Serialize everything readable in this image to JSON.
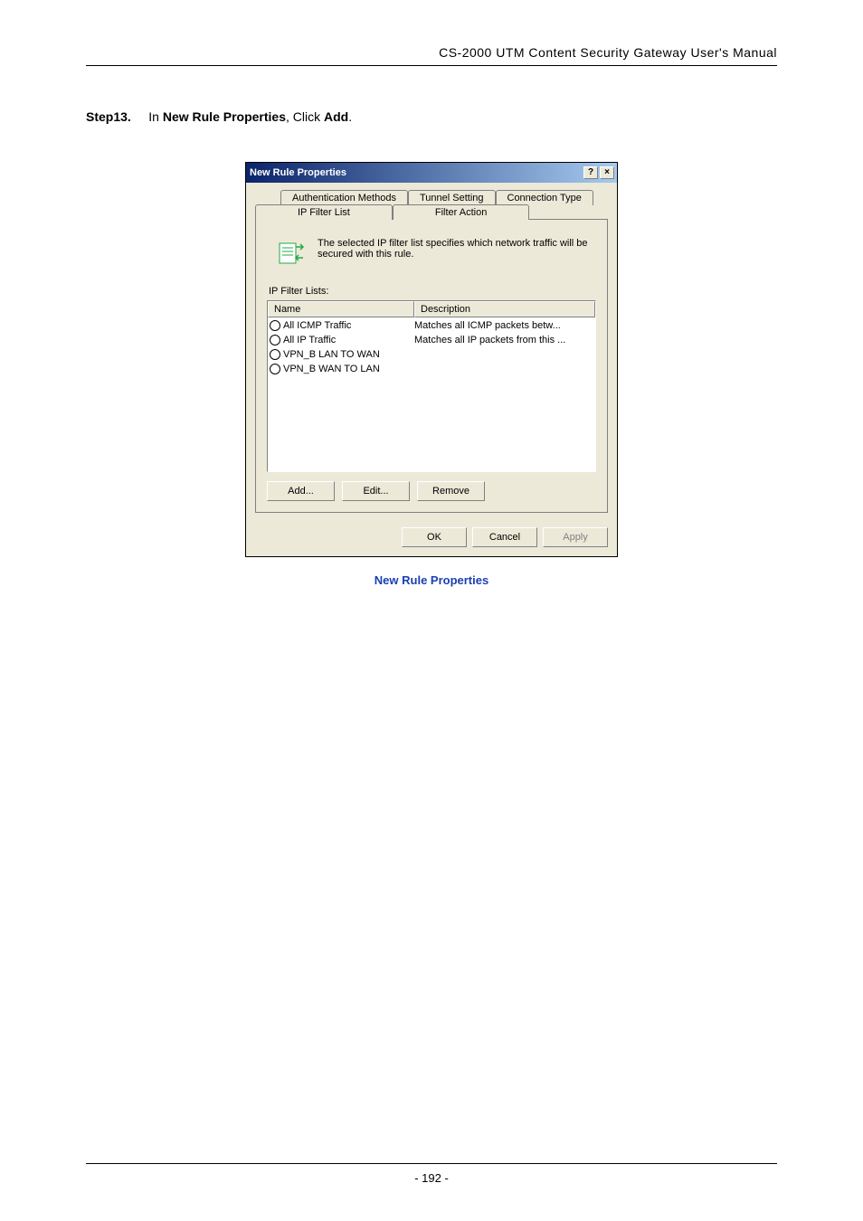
{
  "header": {
    "title": "CS-2000 UTM Content Security Gateway User's Manual"
  },
  "step": {
    "label": "Step13.",
    "pre": "In ",
    "bold1": "New Rule Properties",
    "mid": ", Click ",
    "bold2": "Add",
    "post": "."
  },
  "dialog": {
    "title": "New Rule Properties",
    "help": "?",
    "close": "×",
    "tabs_back": [
      "Authentication Methods",
      "Tunnel Setting",
      "Connection Type"
    ],
    "tabs_front": [
      "IP Filter List",
      "Filter Action"
    ],
    "info": "The selected IP filter list specifies which network traffic will be secured with this rule.",
    "list_label": "IP Filter Lists:",
    "columns": [
      "Name",
      "Description"
    ],
    "rows": [
      {
        "name": "All ICMP Traffic",
        "desc": "Matches all ICMP packets betw..."
      },
      {
        "name": "All IP Traffic",
        "desc": "Matches all IP packets from this ..."
      },
      {
        "name": "VPN_B LAN TO WAN",
        "desc": ""
      },
      {
        "name": "VPN_B WAN TO LAN",
        "desc": ""
      }
    ],
    "buttons": {
      "add": "Add...",
      "edit": "Edit...",
      "remove": "Remove"
    },
    "footer": {
      "ok": "OK",
      "cancel": "Cancel",
      "apply": "Apply"
    }
  },
  "caption": "New Rule Properties",
  "footer": {
    "page": "- 192 -"
  }
}
